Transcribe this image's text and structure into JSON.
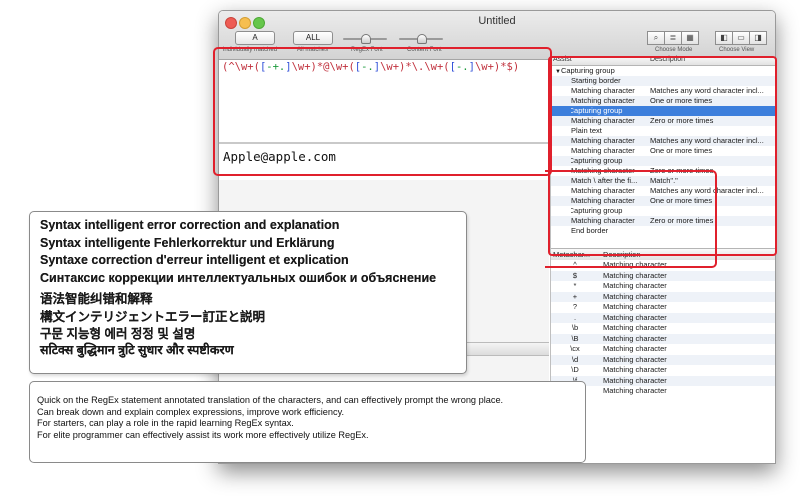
{
  "window": {
    "title": "Untitled",
    "toolbar": {
      "button_a": "A",
      "button_all": "ALL",
      "label_individually": "individually matched",
      "label_all": "All matches",
      "label_regex_font": "RegEx Font",
      "label_content_font": "Content Font",
      "label_choose_mode": "Choose Mode",
      "label_choose_view": "Choose View"
    }
  },
  "editor": {
    "regex_parts": [
      {
        "text": "(^\\w+(",
        "color": "#c0303c"
      },
      {
        "text": "[",
        "color": "#2f4fd8"
      },
      {
        "text": "-+.",
        "color": "#1a9a3a"
      },
      {
        "text": "]",
        "color": "#2f4fd8"
      },
      {
        "text": "\\w+)*@\\w+(",
        "color": "#c0303c"
      },
      {
        "text": "[",
        "color": "#2f4fd8"
      },
      {
        "text": "-.",
        "color": "#1a9a3a"
      },
      {
        "text": "]",
        "color": "#2f4fd8"
      },
      {
        "text": "\\w+)*\\.\\w+(",
        "color": "#c0303c"
      },
      {
        "text": "[",
        "color": "#2f4fd8"
      },
      {
        "text": "-.",
        "color": "#1a9a3a"
      },
      {
        "text": "]",
        "color": "#2f4fd8"
      },
      {
        "text": "\\w+)*$)",
        "color": "#c0303c"
      }
    ],
    "test_text": "Apple@apple.com"
  },
  "assist": {
    "header_assist": "Assist",
    "header_description": "Description",
    "rows": [
      {
        "indent": 0,
        "arrow": "▼",
        "assist": "Capturing group",
        "desc": "",
        "selected": false
      },
      {
        "indent": 1,
        "arrow": "",
        "assist": "Starting border",
        "desc": "",
        "selected": false
      },
      {
        "indent": 1,
        "arrow": "",
        "assist": "Matching character",
        "desc": "Matches any word character incl...",
        "selected": false
      },
      {
        "indent": 1,
        "arrow": "",
        "assist": "Matching character",
        "desc": "One or more times",
        "selected": false
      },
      {
        "indent": 1,
        "arrow": "▶",
        "assist": "Capturing group",
        "desc": "",
        "selected": true
      },
      {
        "indent": 1,
        "arrow": "",
        "assist": "Matching character",
        "desc": "Zero or more times",
        "selected": false
      },
      {
        "indent": 1,
        "arrow": "",
        "assist": "Plain text",
        "desc": "",
        "selected": false
      },
      {
        "indent": 1,
        "arrow": "",
        "assist": "Matching character",
        "desc": "Matches any word character incl...",
        "selected": false
      },
      {
        "indent": 1,
        "arrow": "",
        "assist": "Matching character",
        "desc": "One or more times",
        "selected": false
      },
      {
        "indent": 1,
        "arrow": "▶",
        "assist": "Capturing group",
        "desc": "",
        "selected": false
      },
      {
        "indent": 1,
        "arrow": "",
        "assist": "Matching character",
        "desc": "Zero or more times",
        "selected": false
      },
      {
        "indent": 1,
        "arrow": "",
        "assist": "Match \\ after the fi...",
        "desc": "Match\".\"",
        "selected": false
      },
      {
        "indent": 1,
        "arrow": "",
        "assist": "Matching character",
        "desc": "Matches any word character incl...",
        "selected": false
      },
      {
        "indent": 1,
        "arrow": "",
        "assist": "Matching character",
        "desc": "One or more times",
        "selected": false
      },
      {
        "indent": 1,
        "arrow": "▶",
        "assist": "Capturing group",
        "desc": "",
        "selected": false
      },
      {
        "indent": 1,
        "arrow": "",
        "assist": "Matching character",
        "desc": "Zero or more times",
        "selected": false
      },
      {
        "indent": 1,
        "arrow": "",
        "assist": "End border",
        "desc": "",
        "selected": false
      }
    ]
  },
  "metachar": {
    "header_symbol": "Metachar...",
    "header_description": "Description",
    "rows": [
      {
        "symbol": "^",
        "desc": "Matching character"
      },
      {
        "symbol": "$",
        "desc": "Matching character"
      },
      {
        "symbol": "*",
        "desc": "Matching character"
      },
      {
        "symbol": "+",
        "desc": "Matching character"
      },
      {
        "symbol": "?",
        "desc": "Matching character"
      },
      {
        "symbol": ".",
        "desc": "Matching character"
      },
      {
        "symbol": "\\b",
        "desc": "Matching character"
      },
      {
        "symbol": "\\B",
        "desc": "Matching character"
      },
      {
        "symbol": "\\cx",
        "desc": "Matching character"
      },
      {
        "symbol": "\\d",
        "desc": "Matching character"
      },
      {
        "symbol": "\\D",
        "desc": "Matching character"
      },
      {
        "symbol": "\\f",
        "desc": "Matching character"
      },
      {
        "symbol": "\\n",
        "desc": "Matching character"
      }
    ]
  },
  "feature_panel": {
    "lines": [
      "Syntax intelligent error correction and explanation",
      "Syntax intelligente Fehlerkorrektur und Erklärung",
      "Syntaxe correction d'erreur intelligent et explication",
      "Синтаксис коррекции интеллектуальных ошибок и объяснение",
      "语法智能纠错和解释",
      "構文インテリジェントエラー訂正と説明",
      "구문 지능형 에러 정정 및 설명",
      "सटिक्स बुद्धिमान त्रुटि सुधार और स्पष्टीकरण"
    ]
  },
  "description_panel": {
    "lines": [
      "Quick on the RegEx statement annotated translation of the characters, and can effectively prompt the wrong place.",
      "Can break down and explain complex expressions, improve work efficiency.",
      "For starters, can play a role in the rapid learning RegEx syntax.",
      "For elite programmer can effectively assist its work more effectively utilize RegEx."
    ]
  },
  "colors": {
    "callout": "#e0202c",
    "selection": "#3d7fdc"
  }
}
